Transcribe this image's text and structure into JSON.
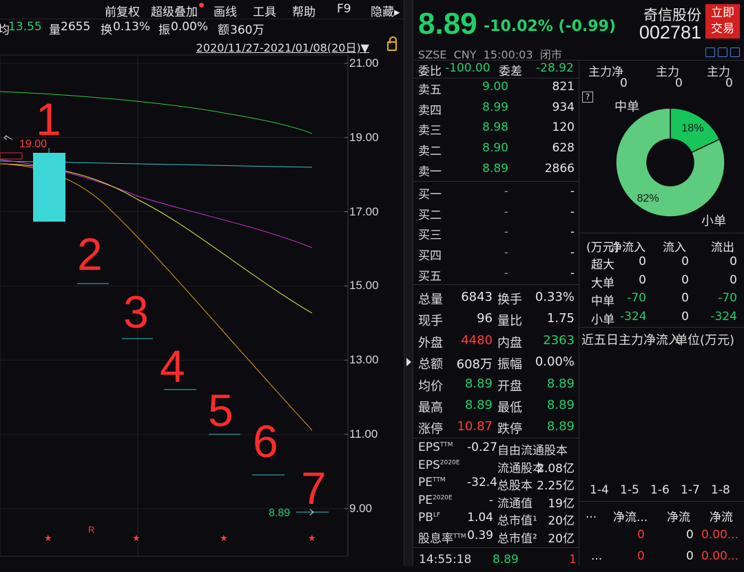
{
  "menu": {
    "items": [
      "前复权",
      "超级叠加",
      "画线",
      "工具",
      "帮助",
      "F9",
      "隐藏▸"
    ]
  },
  "info": {
    "avg_label": "均",
    "avg_value": "13.55",
    "vol_label": "量",
    "vol_value": "2655",
    "turn_label": "换",
    "turn_value": "0.13%",
    "amp_label": "振",
    "amp_value": "0.00%",
    "amt_label": "额",
    "amt_value": "360万"
  },
  "range": "2020/11/27-2021/01/08(20日)▼",
  "chart": {
    "y_ticks": [
      "21.00",
      "19.00",
      "17.00",
      "15.00",
      "13.00",
      "11.00",
      "9.00"
    ],
    "high_marker": "19.00",
    "last_marker": "8.89",
    "numbers": [
      "1",
      "2",
      "3",
      "4",
      "5",
      "6",
      "7"
    ],
    "r_marker": "R",
    "stars": [
      "★",
      "★",
      "★",
      "★",
      "★"
    ]
  },
  "header": {
    "price": "8.89",
    "change": "-10.02% (-0.99)",
    "name": "奇信股份",
    "code": "002781",
    "trade_button": "立即交易",
    "exchange": "SZSE",
    "currency": "CNY",
    "time": "15:00:03",
    "status": "闭市"
  },
  "orderbook": {
    "wei_bi_label": "委比",
    "wei_bi_value": "-100.00",
    "wei_cha_label": "委差",
    "wei_cha_value": "-28.92",
    "sells": [
      {
        "label": "卖五",
        "price": "9.00",
        "vol": "821"
      },
      {
        "label": "卖四",
        "price": "8.99",
        "vol": "934"
      },
      {
        "label": "卖三",
        "price": "8.98",
        "vol": "120"
      },
      {
        "label": "卖二",
        "price": "8.90",
        "vol": "628"
      },
      {
        "label": "卖一",
        "price": "8.89",
        "vol": "2866"
      }
    ],
    "buys": [
      {
        "label": "买一",
        "price": "-",
        "vol": "-"
      },
      {
        "label": "买二",
        "price": "-",
        "vol": "-"
      },
      {
        "label": "买三",
        "price": "-",
        "vol": "-"
      },
      {
        "label": "买四",
        "price": "-",
        "vol": "-"
      },
      {
        "label": "买五",
        "price": "-",
        "vol": "-"
      }
    ]
  },
  "stats": [
    {
      "l1": "总量",
      "v1": "6843",
      "c1": "white",
      "l2": "换手",
      "v2": "0.33%",
      "c2": "white"
    },
    {
      "l1": "现手",
      "v1": "96",
      "c1": "white",
      "l2": "量比",
      "v2": "1.75",
      "c2": "white"
    },
    {
      "l1": "外盘",
      "v1": "4480",
      "c1": "red",
      "l2": "内盘",
      "v2": "2363",
      "c2": "green"
    },
    {
      "l1": "总额",
      "v1": "608万",
      "c1": "white",
      "l2": "振幅",
      "v2": "0.00%",
      "c2": "white"
    },
    {
      "l1": "均价",
      "v1": "8.89",
      "c1": "green",
      "l2": "开盘",
      "v2": "8.89",
      "c2": "green"
    },
    {
      "l1": "最高",
      "v1": "8.89",
      "c1": "green",
      "l2": "最低",
      "v2": "8.89",
      "c2": "green"
    },
    {
      "l1": "涨停",
      "v1": "10.87",
      "c1": "red",
      "l2": "跌停",
      "v2": "8.89",
      "c2": "green"
    }
  ],
  "fundamentals": [
    {
      "l1": "EPS",
      "s1": "TTM",
      "v1": "-0.27",
      "l2": "自由流通股本",
      "v2": ""
    },
    {
      "l1": "EPS",
      "s1": "2020E",
      "v1": "",
      "l2": "流通股本",
      "v2": "2.08亿"
    },
    {
      "l1": "PE",
      "s1": "TTM",
      "v1": "-32.4",
      "l2": "总股本",
      "v2": "2.25亿"
    },
    {
      "l1": "PE",
      "s1": "2020E",
      "v1": "-",
      "l2": "流通值",
      "v2": "19亿"
    },
    {
      "l1": "PB",
      "s1": "LF",
      "v1": "1.04",
      "l2": "总市值¹",
      "v2": "20亿"
    },
    {
      "l1": "股息率",
      "s1": "TTM",
      "v1": "0.39",
      "l2": "总市值²",
      "v2": "20亿"
    }
  ],
  "tick": {
    "time": "14:55:18",
    "price": "8.89",
    "vol": "1"
  },
  "mainflow": {
    "headers": [
      "主力净",
      "主力",
      "主力"
    ],
    "values": [
      "0",
      "0",
      "0"
    ],
    "help": "?",
    "pie_labels": {
      "mid": "中单",
      "small": "小单"
    },
    "pie_data": [
      {
        "name": "中单",
        "pct": 18,
        "label": "18%"
      },
      {
        "name": "小单",
        "pct": 82,
        "label": "82%"
      }
    ]
  },
  "flowtable": {
    "headers": [
      "(万元)",
      "净流入",
      "流入",
      "流出"
    ],
    "rows": [
      {
        "label": "超大",
        "net": "0",
        "in": "0",
        "out": "0",
        "netc": "white",
        "outc": "white"
      },
      {
        "label": "大单",
        "net": "0",
        "in": "0",
        "out": "0",
        "netc": "white",
        "outc": "white"
      },
      {
        "label": "中单",
        "net": "-70",
        "in": "0",
        "out": "-70",
        "netc": "green",
        "outc": "green"
      },
      {
        "label": "小单",
        "net": "-324",
        "in": "0",
        "out": "-324",
        "netc": "green",
        "outc": "green"
      }
    ]
  },
  "fiveday": {
    "title": "近五日主力净流入",
    "unit": "单位(万元)",
    "tabs": [
      "1-4",
      "1-5",
      "1-6",
      "1-7",
      "1-8"
    ]
  },
  "bottomtable": {
    "headers": [
      "...",
      "净流...",
      "净流",
      "净流"
    ],
    "rows": [
      {
        "c0": "",
        "c1": "0",
        "c2": "0",
        "c3": "0.00..."
      },
      {
        "c0": "...",
        "c1": "0",
        "c2": "0",
        "c3": "0.00..."
      }
    ]
  },
  "colors": {
    "up": "#ff3b3b",
    "down": "#1fd06a",
    "brand": "#d21f1f"
  }
}
